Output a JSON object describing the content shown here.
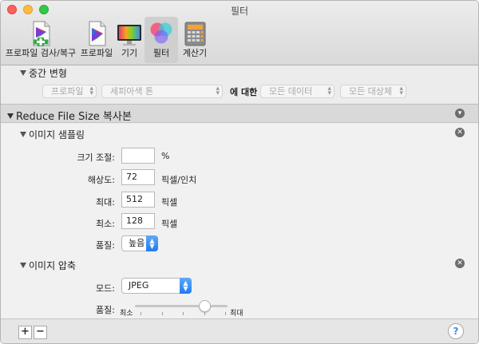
{
  "window": {
    "title": "필터"
  },
  "toolbar": {
    "items": [
      {
        "label": "프로파일 검사/복구",
        "icon": "profile-first-aid-icon"
      },
      {
        "label": "프로파일",
        "icon": "profiles-icon"
      },
      {
        "label": "기기",
        "icon": "devices-icon"
      },
      {
        "label": "필터",
        "icon": "filters-icon",
        "active": true
      },
      {
        "label": "계산기",
        "icon": "calculator-icon"
      }
    ]
  },
  "intermediate": {
    "title": "중간 변형",
    "popup1": "프로파일",
    "popup2": "세피아색 톤",
    "for_label": "에 대한",
    "popup3": "모든 데이터",
    "popup4": "모든 대상체"
  },
  "filter": {
    "title": "Reduce File Size 복사본"
  },
  "sampling": {
    "title": "이미지 샘플링",
    "scale_label": "크기 조절:",
    "scale_value": "",
    "scale_unit": "%",
    "resolution_label": "해상도:",
    "resolution_value": "72",
    "resolution_unit": "픽셀/인치",
    "max_label": "최대:",
    "max_value": "512",
    "max_unit": "픽셀",
    "min_label": "최소:",
    "min_value": "128",
    "min_unit": "픽셀",
    "quality_label": "품질:",
    "quality_value": "높음"
  },
  "compression": {
    "title": "이미지 압축",
    "mode_label": "모드:",
    "mode_value": "JPEG",
    "quality_label": "품질:",
    "quality_min": "최소",
    "quality_max": "최대",
    "quality_level": 0.75
  },
  "bottom": {
    "add_label": "+",
    "remove_label": "−",
    "help_label": "?"
  },
  "colors": {
    "accent": "#1f7cf0",
    "close": "#fc605c",
    "minimize": "#fdbc40",
    "zoom": "#34c84a"
  }
}
